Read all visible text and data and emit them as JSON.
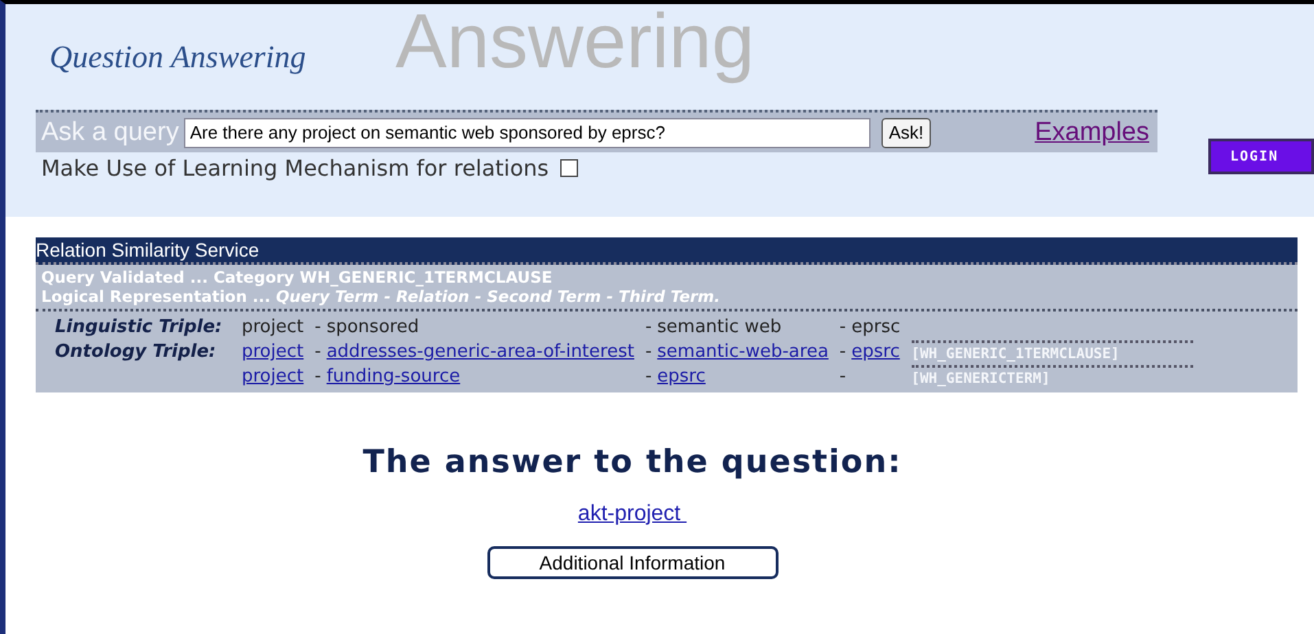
{
  "header": {
    "title_large": "Answering",
    "title_small": "Question Answering"
  },
  "query": {
    "label": "Ask a query",
    "value": "Are there any project on semantic web sponsored by eprsc?",
    "ask_button": "Ask!",
    "examples_link": "Examples"
  },
  "learning": {
    "label": "Make Use of Learning Mechanism for relations",
    "checked": false
  },
  "login_button": "LOGIN",
  "panel": {
    "title": "Relation Similarity Service",
    "validated": "Query Validated ... Category WH_GENERIC_1TERMCLAUSE",
    "representation_prefix": "Logical Representation ...",
    "representation": "Query Term - Relation - Second Term - Third Term.",
    "triples": [
      {
        "label": "Linguistic Triple:",
        "cells": [
          {
            "text": "project",
            "link": false
          },
          {
            "sep": "-",
            "text": "sponsored",
            "link": false
          },
          {
            "sep": "-",
            "text": "semantic web",
            "link": false
          },
          {
            "sep": "-",
            "text": "eprsc",
            "link": false
          }
        ]
      },
      {
        "label": "Ontology Triple:",
        "cells": [
          {
            "text": "project",
            "link": true
          },
          {
            "sep": "-",
            "text": "addresses-generic-area-of-interest",
            "link": true
          },
          {
            "sep": "-",
            "text": "semantic-web-area",
            "link": true
          },
          {
            "sep": "-",
            "text": "epsrc",
            "link": true
          }
        ],
        "category": "[WH_GENERIC_1TERMCLAUSE]"
      },
      {
        "cells": [
          {
            "text": "project",
            "link": true
          },
          {
            "sep": "-",
            "text": "funding-source",
            "link": true
          },
          {
            "sep": "-",
            "text": "epsrc",
            "link": true
          },
          {
            "sep": "-"
          }
        ],
        "category": "[WH_GENERICTERM]"
      }
    ]
  },
  "answer": {
    "heading": "The answer to the question:",
    "result": "akt-project ",
    "info_button": "Additional Information"
  }
}
